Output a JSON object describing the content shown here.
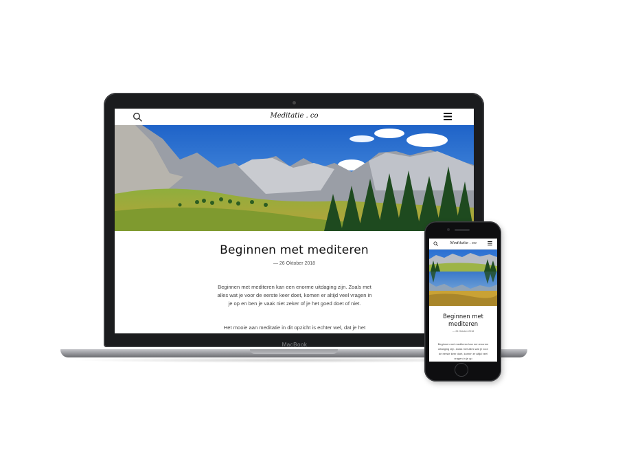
{
  "site": {
    "logo": "Meditatie . co"
  },
  "article": {
    "title": "Beginnen met mediteren",
    "date": "— 26 Oktober 2018",
    "paragraph1": "Beginnen met mediteren kan een enorme uitdaging zijn. Zoals met alles wat je voor de eerste keer doet, komen er altijd veel vragen in je op en ben je vaak niet zeker of je het goed doet of niet.",
    "paragraph2": "Het mooie aan meditatie in dit opzicht is echter wel, dat je het"
  },
  "laptop": {
    "brand_label": "MacBook"
  },
  "mobile": {
    "logo": "Meditatie . co",
    "title": "Beginnen met mediteren",
    "date": "— 26 Oktober 2018",
    "paragraph1": "Beginnen met mediteren kan een enorme uitdaging zijn. Zoals met alles wat je voor de eerste keer doet, komen er altijd veel vragen in je op"
  },
  "icons": {
    "search": "search-icon",
    "menu": "hamburger-menu-icon"
  },
  "colors": {
    "device_dark": "#1b1c1e",
    "text_dark": "#111111",
    "body_text": "#444444"
  }
}
